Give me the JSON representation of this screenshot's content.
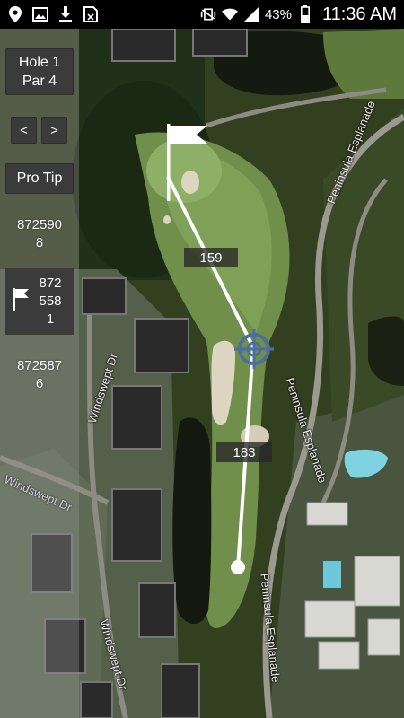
{
  "status_bar": {
    "icons_left": [
      "location-icon",
      "image-icon",
      "download-icon",
      "sim-icon"
    ],
    "icons_right": [
      "vibrate-icon",
      "wifi-icon",
      "signal-icon",
      "battery-icon"
    ],
    "battery": "43%",
    "time": "11:36 AM"
  },
  "panel": {
    "hole": "Hole 1",
    "par": "Par 4",
    "prev_label": "<",
    "next_label": ">",
    "pro_tip_label": "Pro Tip",
    "distance_top_line1": "872590",
    "distance_top_line2": "8",
    "flag_line1": "872",
    "flag_line2": "558",
    "flag_line3": "1",
    "distance_bottom_line1": "872587",
    "distance_bottom_line2": "6"
  },
  "map": {
    "distance_to_pin": "159",
    "distance_from_tee": "183",
    "streets": {
      "peninsula_top": "Peninsula Esplanade",
      "peninsula_mid": "Peninsula Esplanade",
      "peninsula_bottom": "Peninsula Esplanade",
      "windswept_top": "Windswept Dr",
      "windswept_left": "Windswept Dr",
      "windswept_bottom": "Windswept Dr"
    }
  },
  "colors": {
    "button_bg": "#3b3b3b",
    "fairway": "#7a9a55",
    "water": "#1c2114",
    "sand": "#d9d2bf"
  }
}
